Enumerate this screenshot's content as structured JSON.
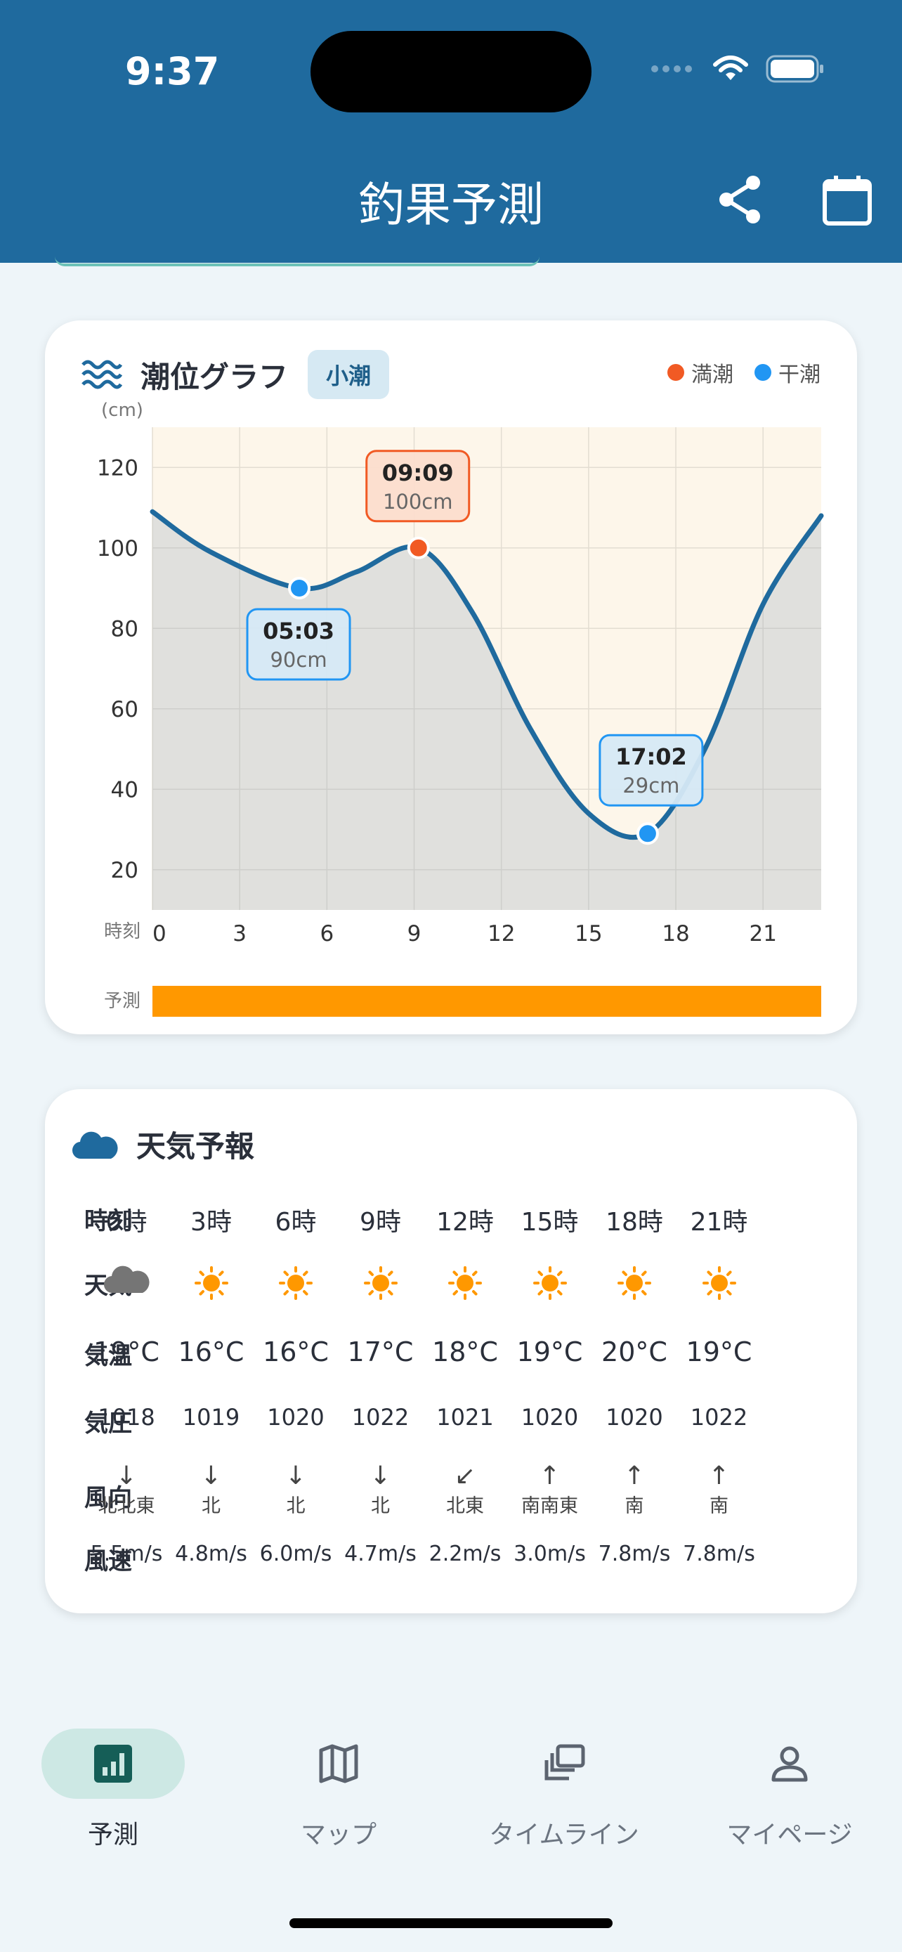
{
  "status_bar": {
    "time": "9:37"
  },
  "header": {
    "title": "釣果予測",
    "share_icon": "share-icon",
    "calendar_icon": "calendar-icon"
  },
  "tide_card": {
    "icon": "waves-icon",
    "title": "潮位グラフ",
    "badge": "小潮",
    "legend": {
      "high": "満潮",
      "low": "干潮",
      "high_color": "#f15a24",
      "low_color": "#2196f3"
    },
    "y_unit": "(cm)",
    "x_label": "時刻",
    "forecast_label": "予測",
    "forecast_bar_color": "#ff9800",
    "line_color": "#1f6a9e"
  },
  "chart_data": {
    "type": "line",
    "title": "潮位グラフ",
    "xlabel": "時刻",
    "ylabel": "(cm)",
    "xlim": [
      0,
      23
    ],
    "ylim": [
      10,
      130
    ],
    "x_ticks": [
      0,
      3,
      6,
      9,
      12,
      15,
      18,
      21
    ],
    "y_ticks": [
      20,
      40,
      60,
      80,
      100,
      120
    ],
    "grid": true,
    "legend_position": "top-right",
    "series": [
      {
        "x": [
          0,
          2,
          5.05,
          7,
          9.15,
          11,
          13,
          15,
          17.03,
          19,
          21,
          23
        ],
        "y": [
          109,
          99,
          90,
          94,
          100,
          84,
          55,
          34,
          29,
          50,
          86,
          108
        ]
      }
    ],
    "annotations": [
      {
        "kind": "low",
        "x": 5.05,
        "y": 90,
        "time": "05:03",
        "value": "90cm"
      },
      {
        "kind": "high",
        "x": 9.15,
        "y": 100,
        "time": "09:09",
        "value": "100cm"
      },
      {
        "kind": "low",
        "x": 17.03,
        "y": 29,
        "time": "17:02",
        "value": "29cm"
      }
    ]
  },
  "weather_card": {
    "icon": "cloud-icon",
    "title": "天気予報",
    "row_labels": {
      "time": "時刻",
      "weather": "天気",
      "temp": "気温",
      "pressure": "気圧",
      "wind_dir": "風向",
      "wind_speed": "風速"
    },
    "columns": [
      {
        "time": "0時",
        "weather": "cloudy",
        "temp": "19°C",
        "pressure": "1018",
        "wind_dir": "北北東",
        "wind_arrow": "↓",
        "wind_speed": "5.5m/s"
      },
      {
        "time": "3時",
        "weather": "sunny",
        "temp": "16°C",
        "pressure": "1019",
        "wind_dir": "北",
        "wind_arrow": "↓",
        "wind_speed": "4.8m/s"
      },
      {
        "time": "6時",
        "weather": "sunny",
        "temp": "16°C",
        "pressure": "1020",
        "wind_dir": "北",
        "wind_arrow": "↓",
        "wind_speed": "6.0m/s"
      },
      {
        "time": "9時",
        "weather": "sunny",
        "temp": "17°C",
        "pressure": "1022",
        "wind_dir": "北",
        "wind_arrow": "↓",
        "wind_speed": "4.7m/s"
      },
      {
        "time": "12時",
        "weather": "sunny",
        "temp": "18°C",
        "pressure": "1021",
        "wind_dir": "北東",
        "wind_arrow": "↙",
        "wind_speed": "2.2m/s"
      },
      {
        "time": "15時",
        "weather": "sunny",
        "temp": "19°C",
        "pressure": "1020",
        "wind_dir": "南南東",
        "wind_arrow": "↑",
        "wind_speed": "3.0m/s"
      },
      {
        "time": "18時",
        "weather": "sunny",
        "temp": "20°C",
        "pressure": "1020",
        "wind_dir": "南",
        "wind_arrow": "↑",
        "wind_speed": "7.8m/s"
      },
      {
        "time": "21時",
        "weather": "sunny",
        "temp": "19°C",
        "pressure": "1022",
        "wind_dir": "南",
        "wind_arrow": "↑",
        "wind_speed": "7.8m/s"
      }
    ]
  },
  "tab_bar": {
    "tabs": [
      {
        "label": "予測",
        "icon": "chart-icon",
        "active": true
      },
      {
        "label": "マップ",
        "icon": "map-icon",
        "active": false
      },
      {
        "label": "タイムライン",
        "icon": "timeline-icon",
        "active": false
      },
      {
        "label": "マイページ",
        "icon": "person-icon",
        "active": false
      }
    ]
  }
}
